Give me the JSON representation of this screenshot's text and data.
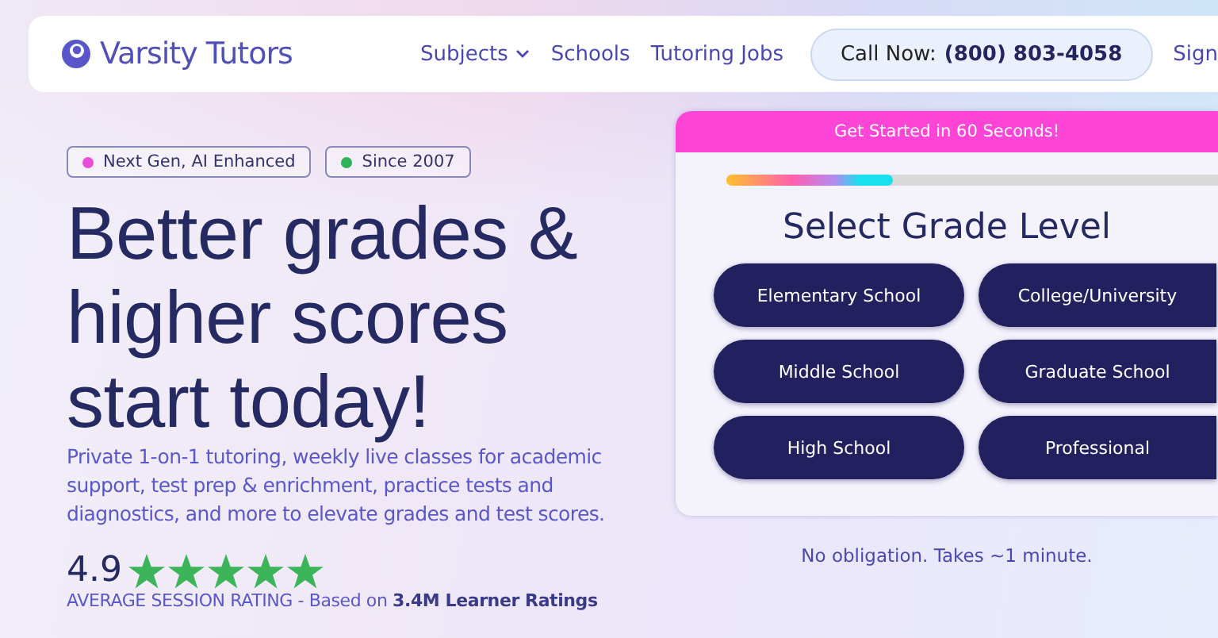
{
  "header": {
    "logo": "Varsity Tutors",
    "nav": [
      {
        "label": "Subjects",
        "kind": "dropdown"
      },
      {
        "label": "Schools",
        "kind": "link"
      },
      {
        "label": "Tutoring Jobs",
        "kind": "link"
      }
    ],
    "call": {
      "label": "Call Now:",
      "phone": "(800) 803-4058"
    },
    "sign_in": "Sign"
  },
  "badges": [
    {
      "label": "Next Gen, AI Enhanced",
      "color": "#e94fd6"
    },
    {
      "label": "Since 2007",
      "color": "#2fb35a"
    }
  ],
  "headline": "Better grades & higher scores start today!",
  "description": "Private 1-on-1 tutoring, weekly live classes for academic support, test prep & enrichment, practice tests and diagnostics, and more to elevate grades and test scores.",
  "rating": {
    "score": "4.9",
    "stars": 5,
    "caption": "AVERAGE SESSION RATING - Based on **3.4M Learner Ratings**"
  },
  "card": {
    "banner": "Get Started in 60 Seconds!",
    "progress": {
      "level": 0.34
    },
    "title": "Select Grade Level",
    "options": [
      "Elementary School",
      "College/University",
      "Middle School",
      "Graduate School",
      "High School",
      "Professional"
    ]
  },
  "note": "No obligation. Takes ~1 minute."
}
